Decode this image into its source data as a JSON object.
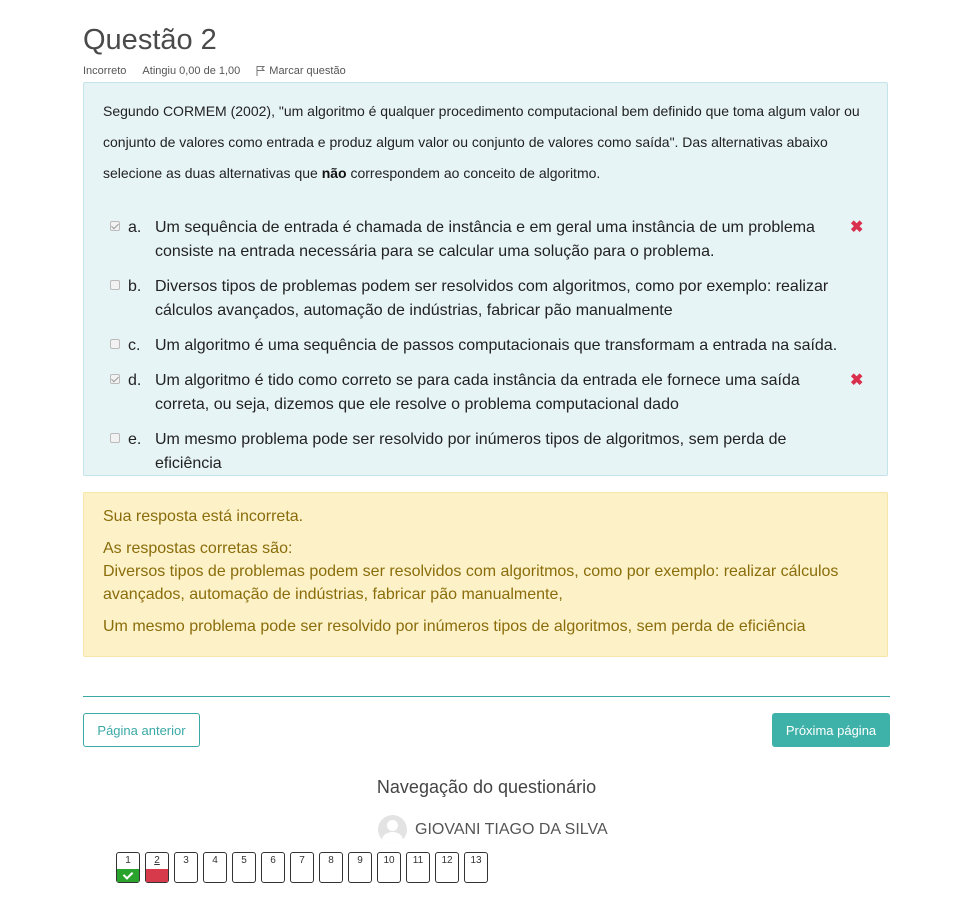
{
  "question": {
    "title": "Questão 2",
    "status": "Incorreto",
    "grade": "Atingiu 0,00 de 1,00",
    "flag_label": "Marcar questão",
    "text_before": "Segundo CORMEM (2002), \"um algoritmo é qualquer procedimento computacional bem definido que toma algum valor ou conjunto de valores como entrada e produz algum valor ou conjunto de valores como saída\". Das alternativas abaixo selecione as duas alternativas que ",
    "text_bold": "não",
    "text_after": " correspondem ao conceito de algoritmo.",
    "options": [
      {
        "letter": "a.",
        "text": "Um sequência de entrada é chamada de instância e em geral uma instância de um problema consiste na entrada necessária para se calcular uma solução para o problema.",
        "checked": true,
        "mark": "✖"
      },
      {
        "letter": "b.",
        "text": "Diversos tipos de problemas podem ser resolvidos com algoritmos, como por exemplo: realizar cálculos avançados, automação de indústrias, fabricar pão manualmente",
        "checked": false
      },
      {
        "letter": "c.",
        "text": "Um algoritmo é uma sequência de passos computacionais que transformam a entrada na saída.",
        "checked": false
      },
      {
        "letter": "d.",
        "text": "Um algoritmo é tido como correto se para cada instância da entrada ele fornece uma saída correta, ou seja, dizemos que ele resolve o problema computacional dado",
        "checked": true,
        "mark": "✖"
      },
      {
        "letter": "e.",
        "text": "Um mesmo problema pode ser resolvido por inúmeros tipos de algoritmos, sem perda de eficiência",
        "checked": false
      }
    ]
  },
  "feedback": {
    "result": "Sua resposta está incorreta.",
    "correct_heading": "As respostas corretas são:",
    "answer_1": "Diversos tipos de problemas podem ser resolvidos com algoritmos, como por exemplo: realizar cálculos avançados, automação de indústrias, fabricar pão manualmente,",
    "answer_2": "Um mesmo problema pode ser resolvido por inúmeros tipos de algoritmos, sem perda de eficiência"
  },
  "buttons": {
    "prev": "Página anterior",
    "next": "Próxima página"
  },
  "navigation": {
    "title": "Navegação do questionário",
    "user_name": "GIOVANI TIAGO DA SILVA",
    "questions": [
      {
        "n": "1",
        "state": "correct"
      },
      {
        "n": "2",
        "state": "incorrect"
      },
      {
        "n": "3",
        "state": "none"
      },
      {
        "n": "4",
        "state": "none"
      },
      {
        "n": "5",
        "state": "none"
      },
      {
        "n": "6",
        "state": "none"
      },
      {
        "n": "7",
        "state": "none"
      },
      {
        "n": "8",
        "state": "none"
      },
      {
        "n": "9",
        "state": "none"
      },
      {
        "n": "10",
        "state": "none"
      },
      {
        "n": "11",
        "state": "none"
      },
      {
        "n": "12",
        "state": "none"
      },
      {
        "n": "13",
        "state": "none"
      }
    ]
  },
  "colors": {
    "accent": "#3aa9a5",
    "incorrect": "#d9304d",
    "correct": "#2aa32c"
  }
}
